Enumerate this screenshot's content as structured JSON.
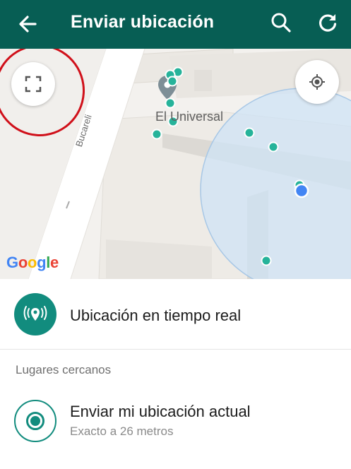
{
  "app_bar": {
    "title": "Enviar ubicación",
    "back_icon": "arrow-left-icon",
    "search_icon": "search-icon",
    "refresh_icon": "refresh-icon",
    "background": "#075e54"
  },
  "map": {
    "landmark_label": "El Universal",
    "street_label": "Bucareli",
    "google_logo": {
      "letters": [
        "G",
        "o",
        "o",
        "g",
        "l",
        "e"
      ],
      "colors": [
        "#4285F4",
        "#EA4335",
        "#FBBC05",
        "#4285F4",
        "#34A853",
        "#EA4335"
      ]
    },
    "fullscreen_icon": "fullscreen-icon",
    "my_location_icon": "my-location-icon",
    "accuracy_circle_color": "#cfe3f5",
    "current_location_color": "#4285F4",
    "place_marker_color": "#26b39a"
  },
  "live_location": {
    "label": "Ubicación en tiempo real",
    "icon": "live-location-icon"
  },
  "nearby": {
    "header": "Lugares cercanos"
  },
  "send_current": {
    "label": "Enviar mi ubicación actual",
    "accuracy": "Exacto a 26 metros",
    "icon": "current-location-icon"
  },
  "colors": {
    "accent": "#128c7e",
    "annotation": "#d0101a"
  }
}
